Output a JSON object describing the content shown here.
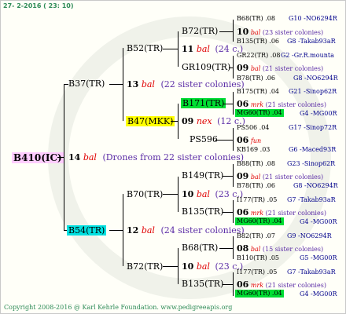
{
  "header": "27-  2-2016 ( 23: 10)",
  "footer": "Copyright 2008-2016 @ Karl Kehrle Foundation.   www.pedigreeapis.org",
  "colors": {
    "root_bg": "#ffccff",
    "queen_cyan": "#00e0e0",
    "queen_yellow": "#ffff00",
    "queen_green": "#00dd33",
    "accent_text": "#e00000",
    "label_blue": "#00008b"
  },
  "tree": {
    "root": {
      "name": "B410(IC)"
    },
    "root_info": {
      "num": "14",
      "tag": "bal",
      "note": "(Drones from 22 sister colonies)"
    },
    "g1": [
      {
        "name": "B37(TR)",
        "num": "13",
        "tag": "bal",
        "note": "(22 sister colonies)"
      },
      {
        "name": "B54(TR)",
        "num": "12",
        "tag": "bal",
        "note": "(24 sister colonies)"
      }
    ],
    "g2": [
      {
        "name": "B52(TR)",
        "num": "11",
        "tag": "bal",
        "note": "(24 c.)"
      },
      {
        "name": "B47(MKK)",
        "num": "09",
        "tag": "nex",
        "note": "(12 c.)"
      },
      {
        "name": "B70(TR)",
        "num": "10",
        "tag": "bal",
        "note": "(23 c.)"
      },
      {
        "name": "B72(TR)",
        "num": "10",
        "tag": "bal",
        "note": "(23 c.)"
      }
    ],
    "g3": [
      {
        "name": "B72(TR)",
        "num": "10",
        "tag": "bal",
        "note": "(23 sister colonies)"
      },
      {
        "name": "GR109(TR)",
        "num": "09",
        "tag": "bal",
        "note": "(21 sister colonies)"
      },
      {
        "name": "B171(TR)",
        "num": "06",
        "tag": "mrk",
        "note": "(21 sister colonies)"
      },
      {
        "name": "PS596",
        "num": "06",
        "tag": "fun",
        "note": ""
      },
      {
        "name": "B149(TR)",
        "num": "09",
        "tag": "bal",
        "note": "(21 sister colonies)"
      },
      {
        "name": "B135(TR)",
        "num": "06",
        "tag": "mrk",
        "note": "(21 sister colonies)"
      },
      {
        "name": "B68(TR)",
        "num": "08",
        "tag": "bal",
        "note": "(15 sister colonies)"
      },
      {
        "name": "B135(TR)",
        "num": "06",
        "tag": "mrk",
        "note": "(21 sister colonies)"
      }
    ],
    "g4": [
      {
        "left": "B68(TR) .08",
        "right": "G10 -NO6294R"
      },
      {
        "left": "B135(TR) .06",
        "right": "G8 -Takab93aR"
      },
      {
        "left": "GR22(TR) .08",
        "right": "G2 -Gr.R.mounta"
      },
      {
        "left": "B78(TR) .06",
        "right": "G8 -NO6294R"
      },
      {
        "left": "B175(TR) .04",
        "right": "G21 -Sinop62R"
      },
      {
        "left": "MG60(TR) .04",
        "right": "G4 -MG00R"
      },
      {
        "left": "PS506 .04",
        "right": "G17 -Sinop72R"
      },
      {
        "left": "KB169 .03",
        "right": "G6 -Maced93R"
      },
      {
        "left": "B88(TR) .08",
        "right": "G23 -Sinop62R"
      },
      {
        "left": "B78(TR) .06",
        "right": "G8 -NO6294R"
      },
      {
        "left": "I177(TR) .05",
        "right": "G7 -Takab93aR"
      },
      {
        "left": "MG60(TR) .04",
        "right": "G4 -MG00R"
      },
      {
        "left": "B82(TR) .07",
        "right": "G9 -NO6294R"
      },
      {
        "left": "B110(TR) .05",
        "right": "G5 -MG00R"
      },
      {
        "left": "I177(TR) .05",
        "right": "G7 -Takab93aR"
      },
      {
        "left": "MG60(TR) .04",
        "right": "G4 -MG00R"
      }
    ]
  }
}
